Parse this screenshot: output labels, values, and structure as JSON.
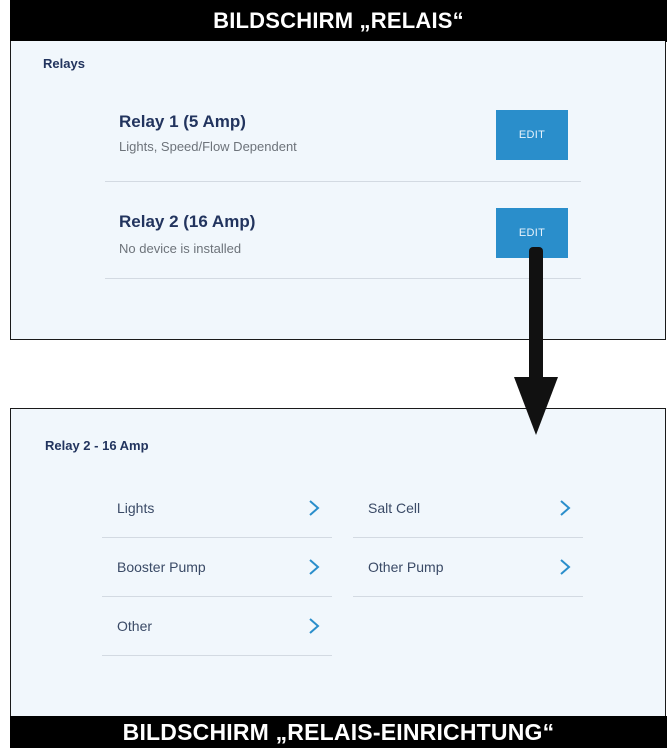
{
  "banners": {
    "top": "BILDSCHIRM „RELAIS“",
    "bottom": "BILDSCHIRM „RELAIS-EINRICHTUNG“"
  },
  "relays_screen": {
    "title": "Relays",
    "items": [
      {
        "name": "Relay 1 (5 Amp)",
        "description": "Lights, Speed/Flow Dependent",
        "edit_label": "EDIT"
      },
      {
        "name": "Relay 2 (16 Amp)",
        "description": "No device is installed",
        "edit_label": "EDIT"
      }
    ]
  },
  "relay_setup_screen": {
    "title": "Relay 2 - 16 Amp",
    "left_options": [
      "Lights",
      "Booster Pump",
      "Other"
    ],
    "right_options": [
      "Salt Cell",
      "Other Pump"
    ]
  },
  "colors": {
    "panel_bg": "#f1f7fc",
    "title_text": "#22345e",
    "button_bg": "#2a8ecb",
    "chevron": "#2a8ecb",
    "banner_bg": "#000000"
  },
  "icons": {
    "chevron": "chevron-right-icon",
    "arrow": "down-arrow-icon"
  }
}
